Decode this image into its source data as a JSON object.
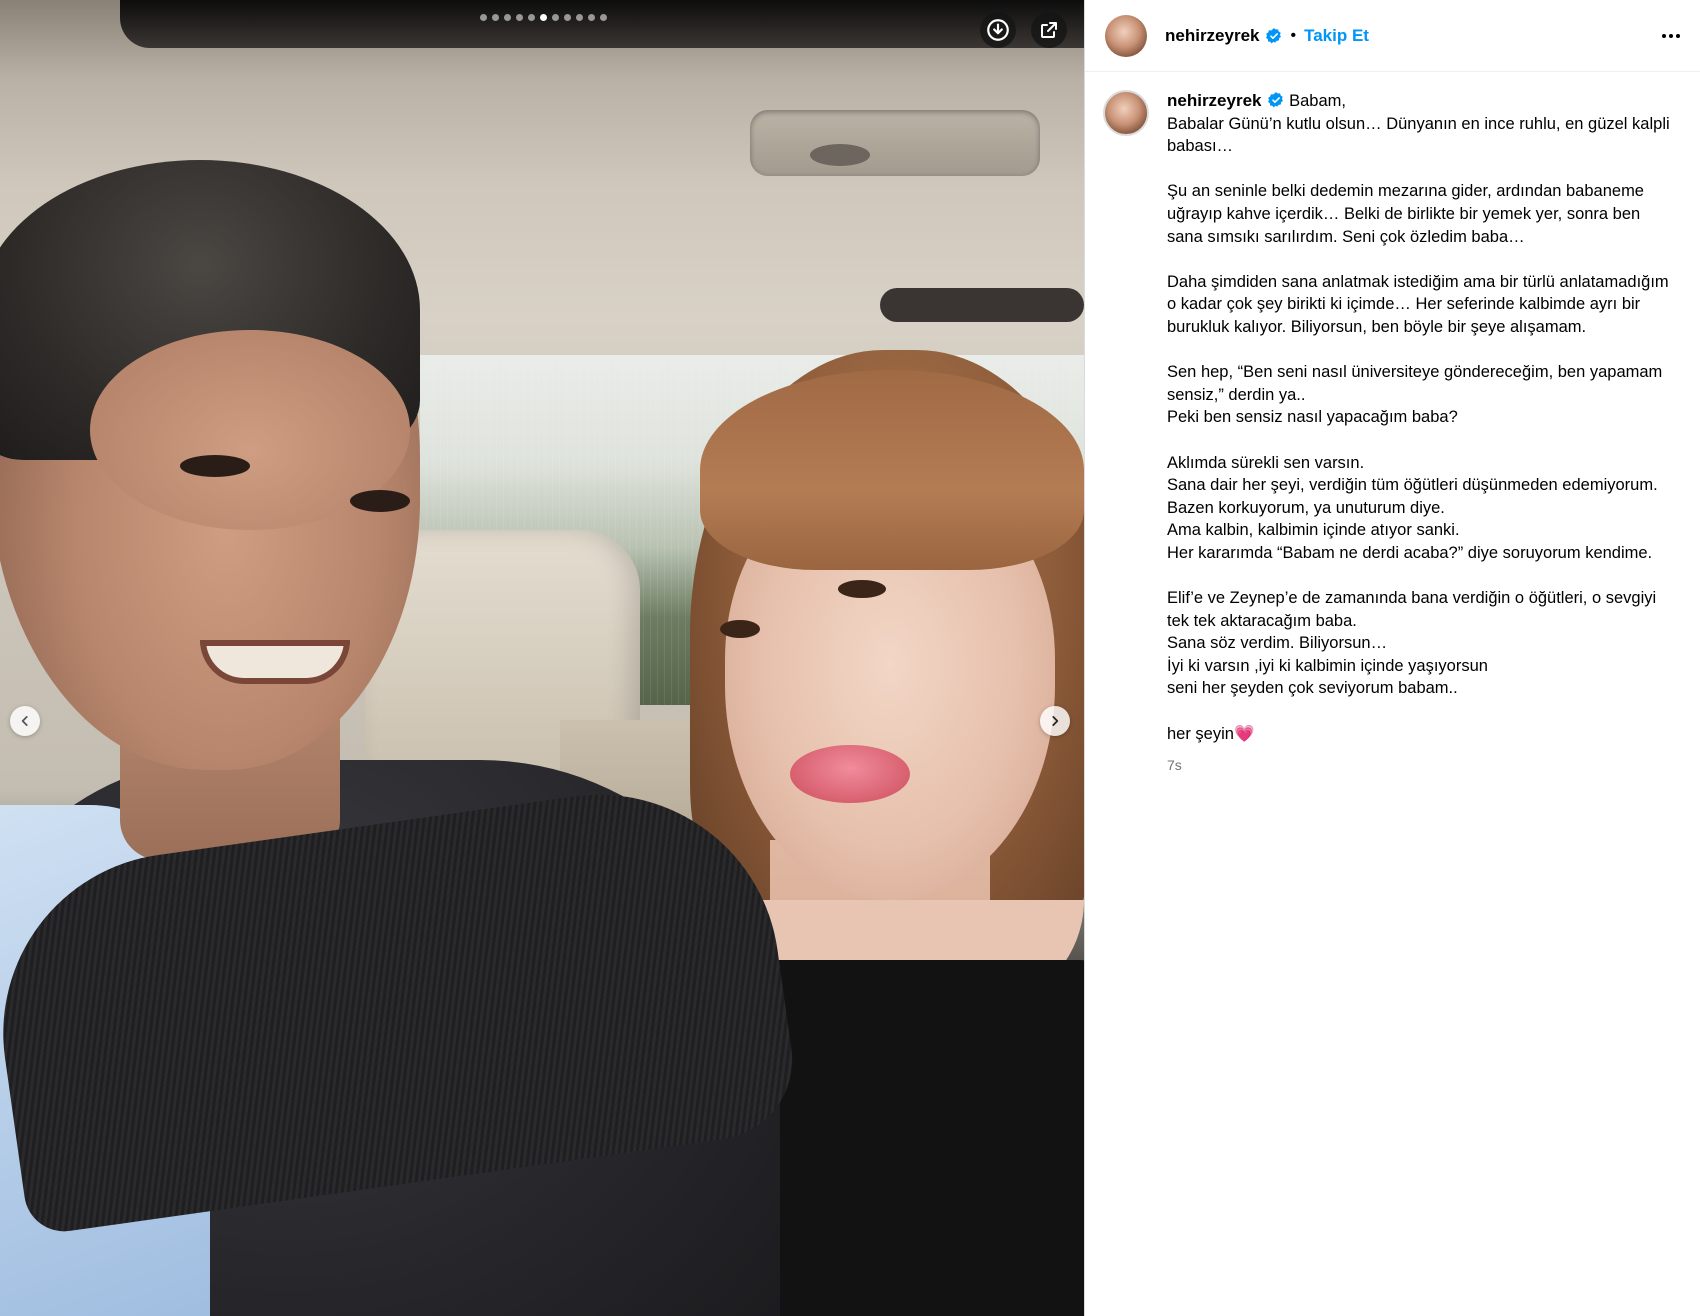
{
  "carousel": {
    "dot_count": 11,
    "active_index": 5,
    "download_icon": "download-circle-icon",
    "share_icon": "external-link-icon",
    "prev_icon": "chevron-left-icon",
    "next_icon": "chevron-right-icon"
  },
  "header": {
    "username": "nehirzeyrek",
    "verified": true,
    "separator": "•",
    "follow_label": "Takip Et",
    "more_icon": "more-horizontal-icon"
  },
  "post": {
    "username": "nehirzeyrek",
    "caption_first_line": "Babam,",
    "caption": "Babalar Günü’n kutlu olsun… Dünyanın en ince ruhlu, en güzel kalpli babası…\n\nŞu an seninle belki dedemin mezarına gider, ardından babaneme uğrayıp kahve içerdik… Belki de birlikte bir yemek yer, sonra ben sana sımsıkı sarılırdım. Seni çok özledim baba…\n\nDaha şimdiden sana anlatmak istediğim ama bir türlü anlatamadığım o kadar çok şey birikti ki içimde… Her seferinde kalbimde ayrı bir burukluk kalıyor. Biliyorsun, ben böyle bir şeye alışamam.\n\nSen hep, “Ben seni nasıl üniversiteye göndereceğim, ben yapamam sensiz,” derdin ya..\nPeki ben sensiz nasıl yapacağım baba?\n\nAklımda sürekli sen varsın.\nSana dair her şeyi, verdiğin tüm öğütleri düşünmeden edemiyorum.\nBazen korkuyorum, ya unuturum diye.\nAma kalbin, kalbimin içinde atıyor sanki.\nHer kararımda “Babam ne derdi acaba?” diye soruyorum kendime.\n\nElif’e ve Zeynep’e de zamanında bana verdiğin o öğütleri, o sevgiyi tek tek aktaracağım baba.\nSana söz verdim. Biliyorsun…\nİyi ki varsın ,iyi ki kalbimin içinde yaşıyorsun\nseni her şeyden çok seviyorum babam..\n\nher şeyin",
    "caption_emoji": "💗",
    "timestamp": "7s"
  },
  "colors": {
    "accent": "#0095f6",
    "verified_badge": "#0095f6",
    "muted_text": "#737373",
    "border": "#dbdbdb"
  }
}
